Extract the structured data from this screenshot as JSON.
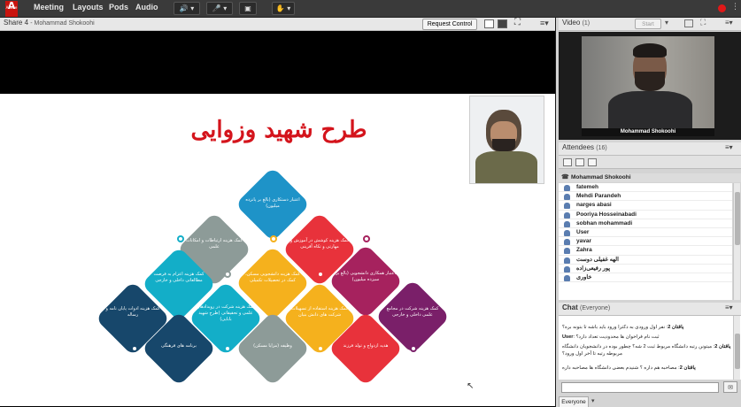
{
  "menubar": {
    "logo_text": "Adobe",
    "items": [
      "Meeting",
      "Layouts",
      "Pods",
      "Audio"
    ]
  },
  "share_pod": {
    "title": "Share 4",
    "presenter": "Mohammad Shokoohi",
    "request_control_label": "Request Control"
  },
  "slide": {
    "title": "طرح شهید وزوایی",
    "diamonds": [
      {
        "text": "اعتبار دستکاری (بالغ بر پانزده میلیون)",
        "color": "#1e93c8"
      },
      {
        "text": "کمک هزینه ارتباطات و امکانات علمی",
        "color": "#8d9b98"
      },
      {
        "text": "کمک هزینه کوشش در آموزش و مهارتی و تکاه آفرینی",
        "color": "#e8323b"
      },
      {
        "text": "کمک هزینه اعزام به فرصت مطالعاتی داخلی و خارجی",
        "color": "#13aec8"
      },
      {
        "text": "کمک هزینه دانشجویی مسکن، کمک در تحصیلات تکمیلی",
        "color": "#f5b11d"
      },
      {
        "text": "اعتبار همکاری دانشجویی (بالغ بر سیزده میلیون)",
        "color": "#a6225e"
      },
      {
        "text": "کمک هزینه ادوات پایان نامه و رساله",
        "color": "#17476b"
      },
      {
        "text": "کمک هزینه شرکت در رویدادهای علمی و تحقیقاتی (طرح شهید بابایی)",
        "color": "#13aec8"
      },
      {
        "text": "کمک هزینه استفاده از تسهیلات شرکت های دانش بنیان",
        "color": "#f5b11d"
      },
      {
        "text": "کمک هزینه شرکت در مجامع علمی داخلی و خارجی",
        "color": "#7a1f69"
      },
      {
        "text": "برنامه های فرهنگی",
        "color": "#17476b"
      },
      {
        "text": "وظیفه (مزایا مسکن)",
        "color": "#8d9b98"
      },
      {
        "text": "هدیه ازدواج و تولد فرزند",
        "color": "#e8323b"
      }
    ]
  },
  "video_pod": {
    "title": "Video",
    "count": "(1)",
    "start_label": "Start",
    "caption": "Mohammad Shokoohi"
  },
  "attendees_pod": {
    "title": "Attendees",
    "count": "(16)",
    "host": "Mohammad Shokoohi",
    "list": [
      "fatemeh",
      "Mehdi Parandeh",
      "narges abasi",
      "Pooriya Hosseinabadi",
      "sobhan mohammadi",
      "User",
      "yavar",
      "Zahra",
      "الهه غفیلی دوست",
      "پور رفیعی‌زاده",
      "خاوری"
    ]
  },
  "chat_pod": {
    "title": "Chat",
    "scope": "(Everyone)",
    "messages": [
      {
        "sender": "یاقتان 2",
        "text": "نفر اول ورودی به دکترا ورود باید باشه تا بتونه بره؟"
      },
      {
        "sender": "User",
        "text": "ثبت نام فراخوان ها محدودیت تعداد دارد؟"
      },
      {
        "sender": "یاقتان 2",
        "text": "میتونن رتبه دانشگاه مربوط ثبت 2 شه؟ چطور بوده در دانشجویان دانشگاه مربوطه رتبه تا آخر اول ورود؟"
      },
      {
        "sender": "یاقتان 2",
        "text": "مصاحبه هم داره ؟ شنیدم بعضی دانشگاه ها مصاحبه داره"
      }
    ],
    "footer_tab": "Everyone"
  },
  "colors": {
    "accent_red": "#c9140e",
    "menubar_bg": "#3a3a3a",
    "pod_header_bg": "#e7e7e7"
  }
}
